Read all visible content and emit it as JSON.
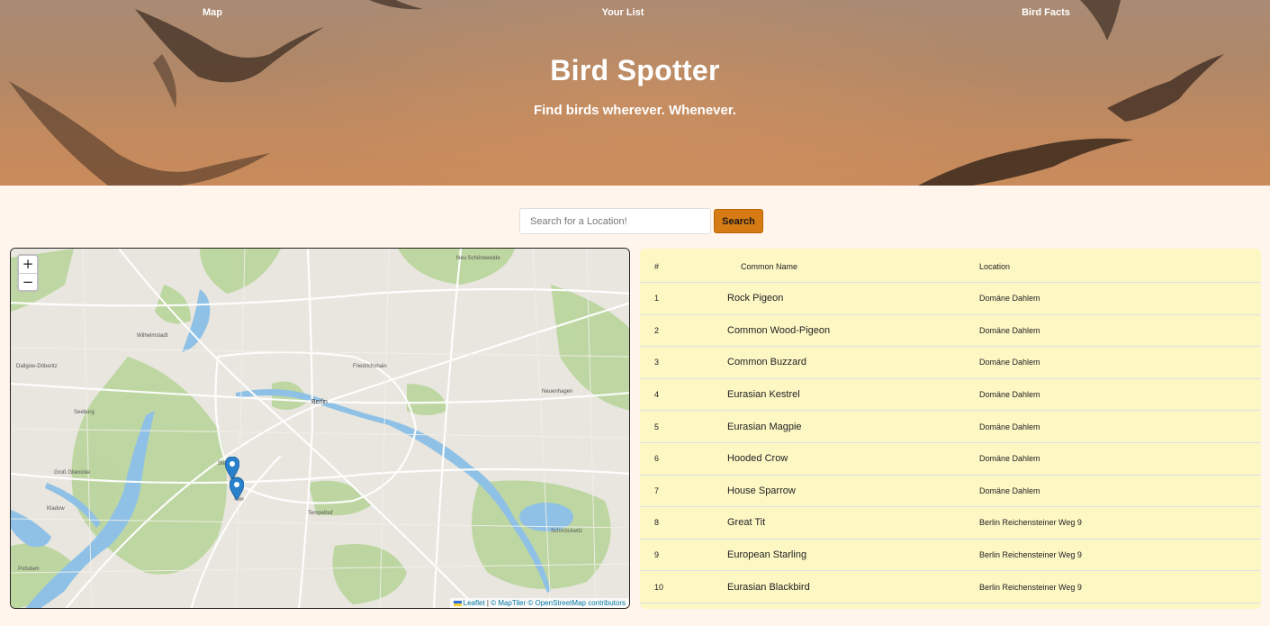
{
  "nav": {
    "items": [
      "Map",
      "Your List",
      "Bird Facts"
    ]
  },
  "header": {
    "title": "Bird Spotter",
    "subtitle": "Find birds wherever. Whenever."
  },
  "search": {
    "placeholder": "Search for a Location!",
    "value": "",
    "button_label": "Search"
  },
  "map": {
    "zoom_in": "+",
    "zoom_out": "−",
    "attribution": {
      "leaflet": "Leaflet",
      "sep1": " | ",
      "maptiler": "© MapTiler",
      "sep2": " ",
      "osm": "© OpenStreetMap contributors"
    },
    "labels": [
      "Berlin",
      "Potsdam",
      "Seeburg",
      "Dallgow-Döberitz",
      "Wilhelmstadt",
      "Kladow",
      "Groß Glienicke",
      "Neu Schöneweide"
    ]
  },
  "table": {
    "headers": [
      "#",
      "Common Name",
      "Location"
    ],
    "rows": [
      {
        "num": "1",
        "name": "Rock Pigeon",
        "location": "Domäne Dahlem"
      },
      {
        "num": "2",
        "name": "Common Wood-Pigeon",
        "location": "Domäne Dahlem"
      },
      {
        "num": "3",
        "name": "Common Buzzard",
        "location": "Domäne Dahlem"
      },
      {
        "num": "4",
        "name": "Eurasian Kestrel",
        "location": "Domäne Dahlem"
      },
      {
        "num": "5",
        "name": "Eurasian Magpie",
        "location": "Domäne Dahlem"
      },
      {
        "num": "6",
        "name": "Hooded Crow",
        "location": "Domäne Dahlem"
      },
      {
        "num": "7",
        "name": "House Sparrow",
        "location": "Domäne Dahlem"
      },
      {
        "num": "8",
        "name": "Great Tit",
        "location": "Berlin Reichensteiner Weg 9"
      },
      {
        "num": "9",
        "name": "European Starling",
        "location": "Berlin Reichensteiner Weg 9"
      },
      {
        "num": "10",
        "name": "Eurasian Blackbird",
        "location": "Berlin Reichensteiner Weg 9"
      }
    ]
  },
  "colors": {
    "page_bg": "#fff5ec",
    "accent": "#d67a13",
    "table_bg": "#fdf7c4",
    "marker": "#2a81cb"
  }
}
